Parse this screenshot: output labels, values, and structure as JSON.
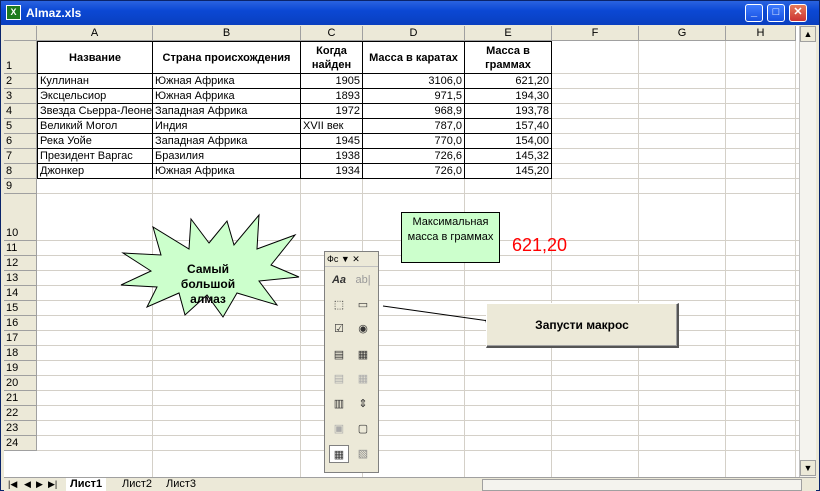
{
  "window": {
    "title": "Almaz.xls",
    "icon": "excel-icon"
  },
  "columns": [
    "A",
    "B",
    "C",
    "D",
    "E",
    "F",
    "G",
    "H"
  ],
  "rows": [
    "1",
    "2",
    "3",
    "4",
    "5",
    "6",
    "7",
    "8",
    "9",
    "10",
    "11",
    "12",
    "13",
    "14",
    "15",
    "16",
    "17",
    "18",
    "19",
    "20",
    "21",
    "22",
    "23",
    "24"
  ],
  "table": {
    "headers": [
      "Название",
      "Страна происхождения",
      "Когда найден",
      "Масса в каратах",
      "Масса в граммах"
    ],
    "data": [
      [
        "Куллинан",
        "Южная Африка",
        "1905",
        "3106,0",
        "621,20"
      ],
      [
        "Эксцельсиор",
        "Южная Африка",
        "1893",
        "971,5",
        "194,30"
      ],
      [
        "Звезда Сьерра-Леоне",
        "Западная Африка",
        "1972",
        "968,9",
        "193,78"
      ],
      [
        "Великий Могол",
        "Индия",
        "XVII век",
        "787,0",
        "157,40"
      ],
      [
        "Река Уойе",
        "Западная Африка",
        "1945",
        "770,0",
        "154,00"
      ],
      [
        "Президент Варгас",
        "Бразилия",
        "1938",
        "726,6",
        "145,32"
      ],
      [
        "Джонкер",
        "Южная Африка",
        "1934",
        "726,0",
        "145,20"
      ]
    ]
  },
  "max_label": "Максимальная масса в граммах",
  "max_value": "621,20",
  "callout": "Самый большой алмаз",
  "toolbox": {
    "title": "Фс ▼ ✕"
  },
  "macro_button": "Запусти макрос",
  "sheets": [
    "Лист1",
    "Лист2",
    "Лист3"
  ],
  "colors": {
    "accent_green": "#ccffcc",
    "value_red": "#ff0000",
    "callout_fill": "#ccffcc"
  }
}
